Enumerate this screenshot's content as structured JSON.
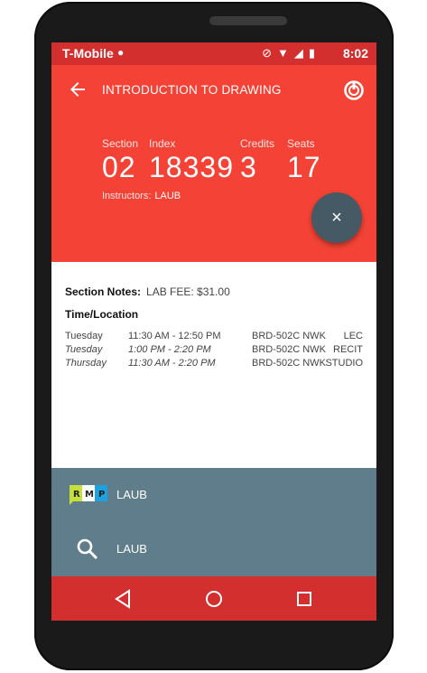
{
  "status_bar": {
    "carrier": "T-Mobile",
    "clock": "8:02",
    "icons": [
      "android-icon",
      "do-not-disturb-icon",
      "wifi-icon",
      "signal-icon",
      "battery-charging-icon"
    ]
  },
  "app_bar": {
    "title": "INTRODUCTION TO DRAWING",
    "back_icon": "arrow-back-icon",
    "action_icon": "power-icon"
  },
  "course": {
    "section_label": "Section",
    "section": "02",
    "index_label": "Index",
    "index": "18339",
    "credits_label": "Credits",
    "credits": "3",
    "seats_label": "Seats",
    "seats": "17",
    "instructors_label": "Instructors:",
    "instructors": "LAUB"
  },
  "fab": {
    "icon": "close-icon",
    "label": "×"
  },
  "details": {
    "notes_label": "Section Notes:",
    "notes_value": "LAB FEE: $31.00",
    "time_location_label": "Time/Location",
    "meetings": [
      {
        "day": "Tuesday",
        "time": "11:30 AM - 12:50 PM",
        "place": "BRD-502C NWK",
        "type": "LEC"
      },
      {
        "day": "Tuesday",
        "time": "1:00 PM - 2:20 PM",
        "place": "BRD-502C NWK",
        "type": "RECIT"
      },
      {
        "day": "Thursday",
        "time": "11:30 AM - 2:20 PM",
        "place": "BRD-502C NWK",
        "type": "STUDIO"
      }
    ]
  },
  "drawer": {
    "rmp_label": "LAUB",
    "rmp_logo_text": "RMP",
    "search_label": "LAUB"
  },
  "nav_bar": {
    "icons": [
      "back-triangle-icon",
      "home-circle-icon",
      "recents-square-icon"
    ]
  },
  "colors": {
    "primary": "#f44336",
    "primary_dark": "#d32f2f",
    "fab": "#455a64",
    "drawer": "#607d8b"
  }
}
